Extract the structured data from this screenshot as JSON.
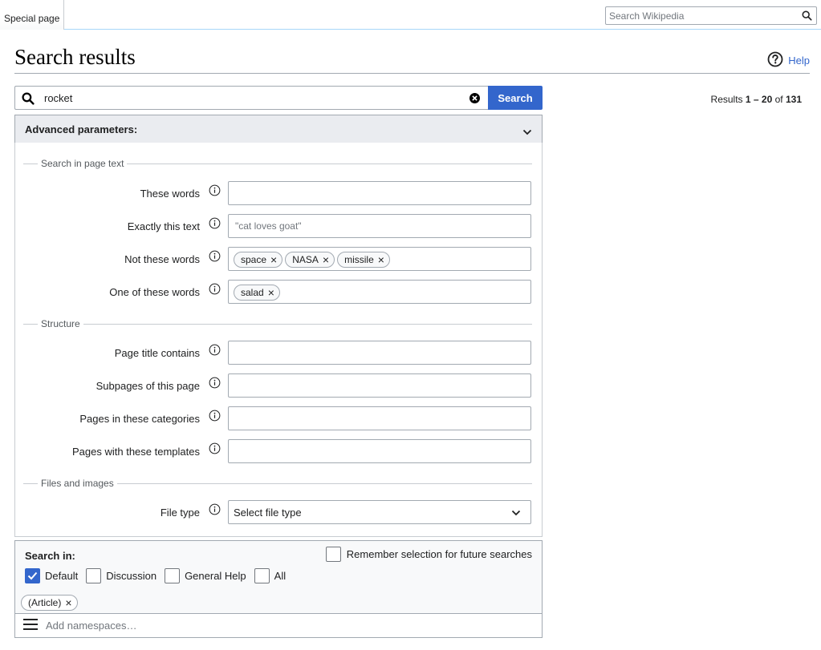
{
  "header": {
    "tab_label": "Special page",
    "search_placeholder": "Search Wikipedia"
  },
  "page": {
    "title": "Search results",
    "help_label": "Help"
  },
  "search": {
    "query": "rocket",
    "button_label": "Search",
    "results_prefix": "Results ",
    "results_range": "1 – 20",
    "results_of": " of ",
    "results_total": "131"
  },
  "advanced": {
    "title": "Advanced parameters:",
    "sections": {
      "page_text": "Search in page text",
      "structure": "Structure",
      "files": "Files and images"
    },
    "fields": {
      "these_words": {
        "label": "These words",
        "value": ""
      },
      "exact_text": {
        "label": "Exactly this text",
        "placeholder": "\"cat loves goat\""
      },
      "not_words": {
        "label": "Not these words",
        "chips": [
          "space",
          "NASA",
          "missile"
        ]
      },
      "one_of_words": {
        "label": "One of these words",
        "chips": [
          "salad"
        ]
      },
      "title_contains": {
        "label": "Page title contains"
      },
      "subpages": {
        "label": "Subpages of this page"
      },
      "categories": {
        "label": "Pages in these categories"
      },
      "templates": {
        "label": "Pages with these templates"
      },
      "file_type": {
        "label": "File type",
        "selected": "Select file type"
      }
    }
  },
  "search_in": {
    "label": "Search in:",
    "remember_label": "Remember selection for future searches",
    "namespaces": [
      {
        "label": "Default",
        "checked": true
      },
      {
        "label": "Discussion",
        "checked": false
      },
      {
        "label": "General Help",
        "checked": false
      },
      {
        "label": "All",
        "checked": false
      }
    ],
    "selected_chip": "(Article)",
    "add_placeholder": "Add namespaces…"
  },
  "colors": {
    "accent": "#3366cc",
    "border": "#a2a9b1",
    "header_bg": "#eaecf0"
  }
}
